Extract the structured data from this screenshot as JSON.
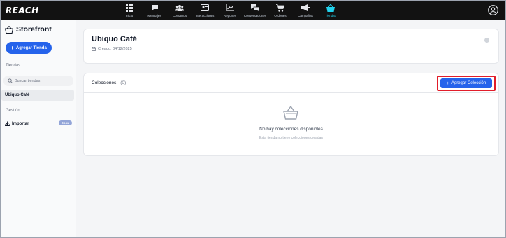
{
  "app": {
    "logo": "REACH"
  },
  "nav": {
    "items": [
      {
        "label": "Inicio",
        "icon": "grid-icon"
      },
      {
        "label": "Mensajes",
        "icon": "chat-icon"
      },
      {
        "label": "Contactos",
        "icon": "users-icon"
      },
      {
        "label": "Interacciones",
        "icon": "id-card-icon"
      },
      {
        "label": "Reportes",
        "icon": "chart-icon"
      },
      {
        "label": "Conversaciones",
        "icon": "conversations-icon"
      },
      {
        "label": "Ordenes",
        "icon": "cart-icon"
      },
      {
        "label": "Campañas",
        "icon": "megaphone-icon"
      },
      {
        "label": "Tiendas",
        "icon": "basket-icon",
        "active": true
      }
    ],
    "active_color": "#22d3ee"
  },
  "sidebar": {
    "title": "Storefront",
    "add_store_label": "Agregar Tienda",
    "stores_section": "Tiendas",
    "search_placeholder": "Buscar tiendas",
    "selected_store": "Ubiquo Café",
    "management_section": "Gestión",
    "import_label": "Importar",
    "soon_badge": "Soon"
  },
  "store": {
    "name": "Ubiquo Café",
    "created": "Creado: 04/12/2025"
  },
  "collections": {
    "title": "Colecciones",
    "count": "(0)",
    "add_label": "Agregar Colección",
    "empty_title": "No hay colecciones disponibles",
    "empty_subtitle": "Esta tienda no tiene colecciones creadas"
  },
  "colors": {
    "primary": "#2563eb",
    "topbar": "#121212",
    "highlight_border": "#e11d2a"
  }
}
